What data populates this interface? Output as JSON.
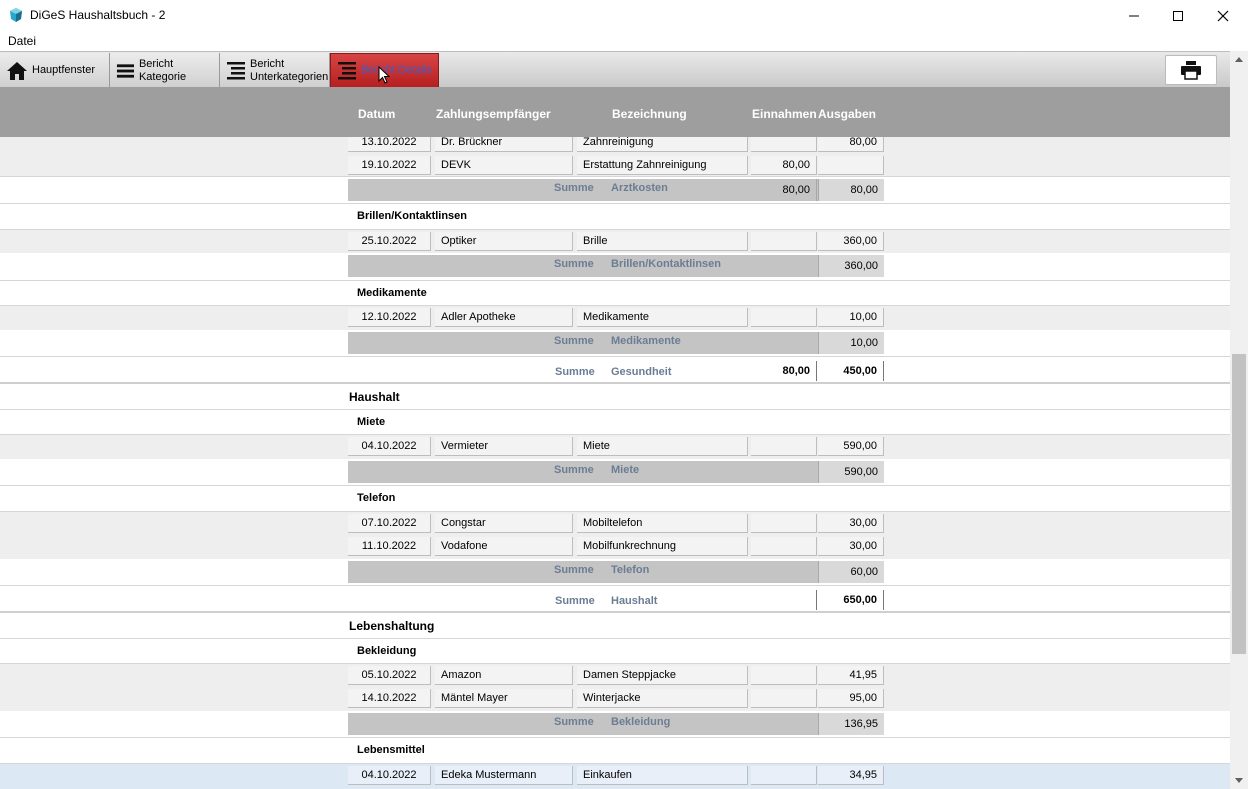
{
  "window": {
    "title": "DiGeS Haushaltsbuch - 2"
  },
  "menu": {
    "file": "Datei"
  },
  "toolbar": {
    "main_window": "Hauptfenster",
    "report_category": "Bericht Kategorie",
    "report_subcategories_line1": "Bericht",
    "report_subcategories_line2": "Unterkategorien",
    "report_details": "Bericht Details"
  },
  "columns": {
    "date": "Datum",
    "payee": "Zahlungsempfänger",
    "description": "Bezeichnung",
    "income": "Einnahmen",
    "expense": "Ausgaben"
  },
  "sum_word": "Summe",
  "rows": {
    "r1": {
      "date": "13.10.2022",
      "payee": "Dr. Brückner",
      "desc": "Zahnreinigung",
      "income": "",
      "expense": "80,00"
    },
    "r2": {
      "date": "19.10.2022",
      "payee": "DEVK",
      "desc": "Erstattung Zahnreinigung",
      "income": "80,00",
      "expense": ""
    },
    "s_arzt": {
      "name": "Arztkosten",
      "income": "80,00",
      "expense": "80,00"
    },
    "cat_brillen": "Brillen/Kontaktlinsen",
    "r3": {
      "date": "25.10.2022",
      "payee": "Optiker",
      "desc": "Brille",
      "income": "",
      "expense": "360,00"
    },
    "s_brillen": {
      "name": "Brillen/Kontaktlinsen",
      "income": "",
      "expense": "360,00"
    },
    "cat_medi": "Medikamente",
    "r4": {
      "date": "12.10.2022",
      "payee": "Adler Apotheke",
      "desc": "Medikamente",
      "income": "",
      "expense": "10,00"
    },
    "s_medi": {
      "name": "Medikamente",
      "income": "",
      "expense": "10,00"
    },
    "t_gesund": {
      "name": "Gesundheit",
      "income": "80,00",
      "expense": "450,00"
    },
    "main_haushalt": "Haushalt",
    "cat_miete": "Miete",
    "r5": {
      "date": "04.10.2022",
      "payee": "Vermieter",
      "desc": "Miete",
      "income": "",
      "expense": "590,00"
    },
    "s_miete": {
      "name": "Miete",
      "income": "",
      "expense": "590,00"
    },
    "cat_telefon": "Telefon",
    "r6": {
      "date": "07.10.2022",
      "payee": "Congstar",
      "desc": "Mobiltelefon",
      "income": "",
      "expense": "30,00"
    },
    "r7": {
      "date": "11.10.2022",
      "payee": "Vodafone",
      "desc": "Mobilfunkrechnung",
      "income": "",
      "expense": "30,00"
    },
    "s_telefon": {
      "name": "Telefon",
      "income": "",
      "expense": "60,00"
    },
    "t_haushalt": {
      "name": "Haushalt",
      "income": "",
      "expense": "650,00"
    },
    "main_leben": "Lebenshaltung",
    "cat_bekl": "Bekleidung",
    "r8": {
      "date": "05.10.2022",
      "payee": "Amazon",
      "desc": "Damen Steppjacke",
      "income": "",
      "expense": "41,95"
    },
    "r9": {
      "date": "14.10.2022",
      "payee": "Mäntel Mayer",
      "desc": "Winterjacke",
      "income": "",
      "expense": "95,00"
    },
    "s_bekl": {
      "name": "Bekleidung",
      "income": "",
      "expense": "136,95"
    },
    "cat_lebensm": "Lebensmittel",
    "r10": {
      "date": "04.10.2022",
      "payee": "Edeka Mustermann",
      "desc": "Einkaufen",
      "income": "",
      "expense": "34,95"
    }
  },
  "colors": {
    "active_tab": "#c62828",
    "header_band": "#9e9e9e",
    "sum_label": "#6b7d93"
  }
}
